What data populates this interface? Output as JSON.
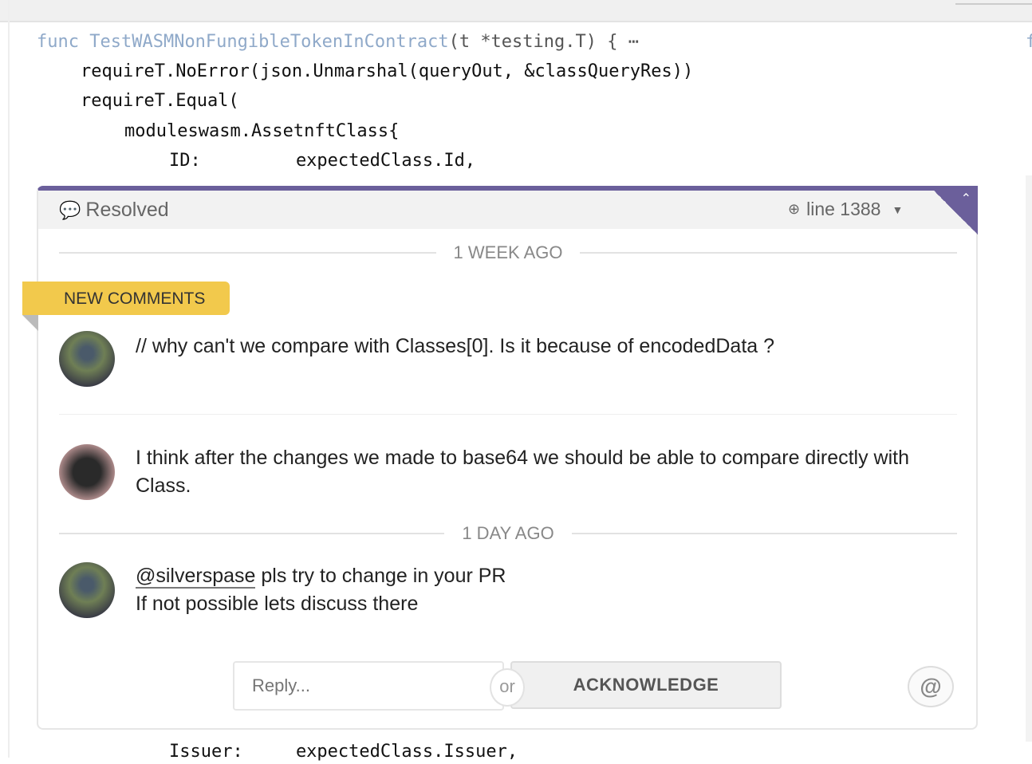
{
  "code": {
    "func_keyword": "func",
    "func_name": "TestWASMNonFungibleTokenInContract",
    "func_sig": "(t *testing.T) { ⋯",
    "lines": [
      "requireT.NoError(json.Unmarshal(queryOut, &classQueryRes))",
      "requireT.Equal(",
      "moduleswasm.AssetnftClass{",
      "ID:         expectedClass.Id,"
    ],
    "bottom_line": "Issuer:     expectedClass.Issuer,",
    "right_fragment": "f"
  },
  "thread": {
    "status": "Resolved",
    "line_label": "line 1388",
    "accent_color": "#6b5f9b",
    "separators": [
      "1 WEEK AGO",
      "1 DAY AGO"
    ],
    "new_comments_badge": "NEW COMMENTS",
    "comments": [
      {
        "text": "// why can't we compare with Classes[0]. Is it because of encodedData ?"
      },
      {
        "text": "I think after the changes we made to base64 we should be able to compare directly with Class."
      },
      {
        "mention": "@silverspase",
        "text": " pls try to change in your PR",
        "text2": "If not possible lets discuss there"
      }
    ],
    "reply_placeholder": "Reply...",
    "or_label": "or",
    "acknowledge_label": "ACKNOWLEDGE",
    "mention_button": "@"
  }
}
